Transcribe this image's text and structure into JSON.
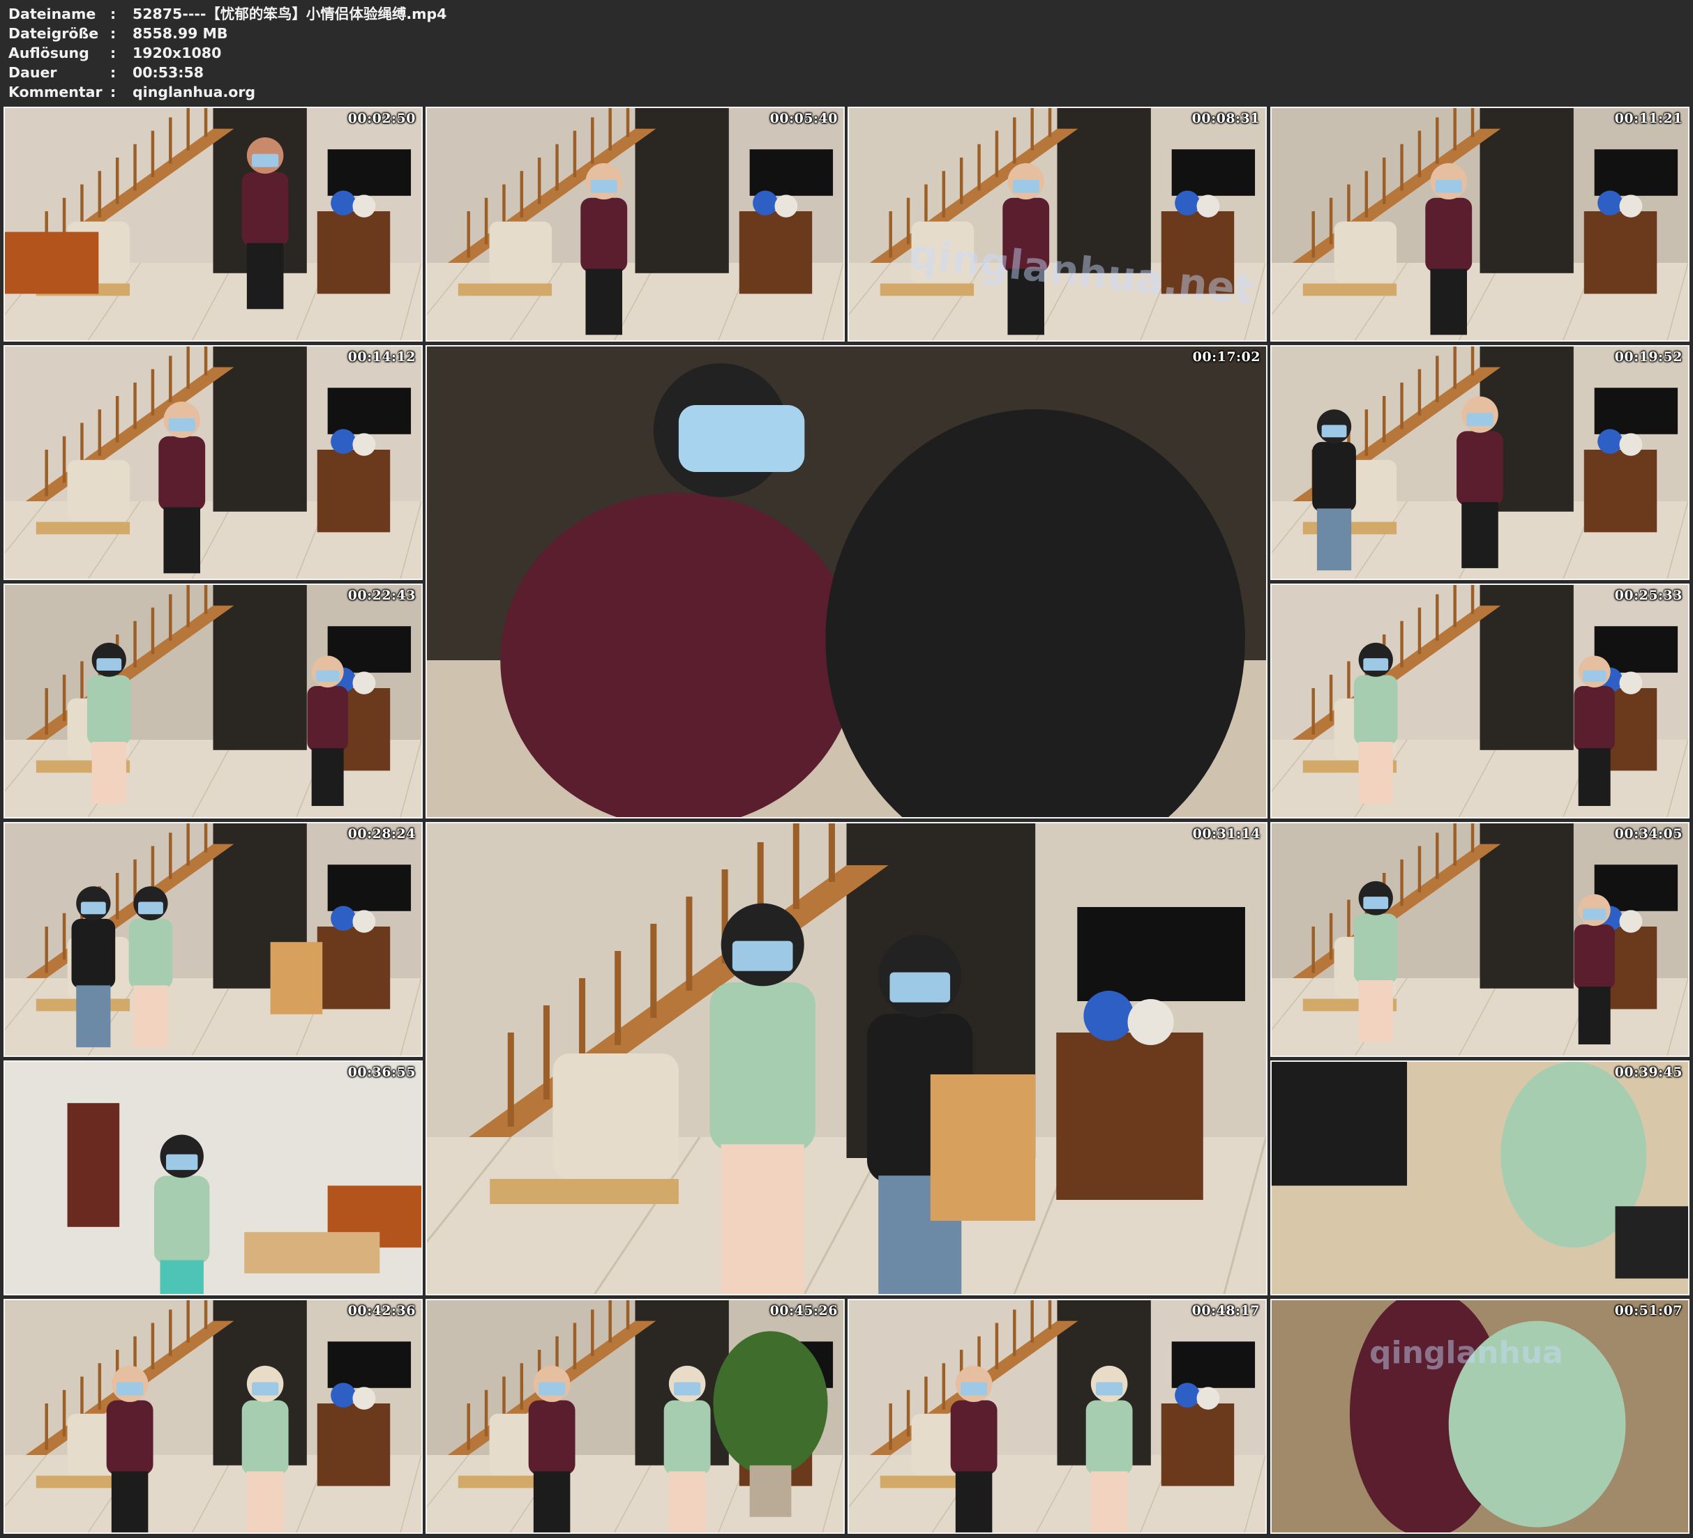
{
  "header": {
    "rows": [
      {
        "key": "Dateiname",
        "sep": ":",
        "value": "52875----【忧郁的笨鸟】小情侣体验绳缚.mp4"
      },
      {
        "key": "Dateigröße",
        "sep": ":",
        "value": "8558.99 MB"
      },
      {
        "key": "Auflösung",
        "sep": ":",
        "value": "1920x1080"
      },
      {
        "key": "Dauer",
        "sep": ":",
        "value": "00:53:58"
      },
      {
        "key": "Kommentar",
        "sep": ":",
        "value": "qinglanhua.org"
      }
    ]
  },
  "thumbnails": [
    {
      "timestamp": "00:02:50"
    },
    {
      "timestamp": "00:05:40"
    },
    {
      "timestamp": "00:08:31"
    },
    {
      "timestamp": "00:11:21"
    },
    {
      "timestamp": "00:14:12"
    },
    {
      "timestamp": "00:17:02"
    },
    {
      "timestamp": "00:19:52"
    },
    {
      "timestamp": "00:22:43"
    },
    {
      "timestamp": "00:25:33"
    },
    {
      "timestamp": "00:28:24"
    },
    {
      "timestamp": "00:31:14"
    },
    {
      "timestamp": "00:34:05"
    },
    {
      "timestamp": "00:36:55"
    },
    {
      "timestamp": "00:39:45"
    },
    {
      "timestamp": "00:42:36"
    },
    {
      "timestamp": "00:45:26"
    },
    {
      "timestamp": "00:48:17"
    },
    {
      "timestamp": "00:51:07"
    }
  ],
  "watermarks": [
    "qinglanhua.net",
    "qinglanhua"
  ],
  "colors": {
    "background": "#2b2b2b",
    "header_text": "#f2f2f2",
    "thumb_border": "#f4f4f4"
  }
}
